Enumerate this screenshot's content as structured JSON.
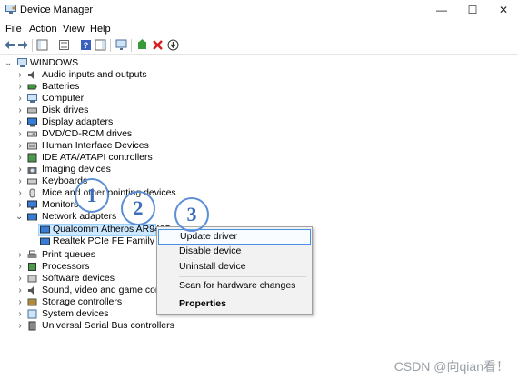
{
  "window": {
    "title": "Device Manager",
    "controls": {
      "minimize": "—",
      "maximize": "☐",
      "close": "✕"
    }
  },
  "menu": [
    "File",
    "Action",
    "View",
    "Help"
  ],
  "toolbar_icons": [
    "back-arrow-icon",
    "forward-arrow-icon",
    "show-hide-icon",
    "properties-icon",
    "help-icon",
    "action-pane-icon",
    "scan-hardware-icon",
    "add-driver-icon",
    "uninstall-icon",
    "update-driver-icon"
  ],
  "tree": {
    "root": "WINDOWS",
    "categories": [
      "Audio inputs and outputs",
      "Batteries",
      "Computer",
      "Disk drives",
      "Display adapters",
      "DVD/CD-ROM drives",
      "Human Interface Devices",
      "IDE ATA/ATAPI controllers",
      "Imaging devices",
      "Keyboards",
      "Mice and other pointing devices",
      "Monitors",
      "Network adapters",
      "Qualcomm Atheros AR9485",
      "Realtek PCIe FE Family Contr",
      "Print queues",
      "Processors",
      "Software devices",
      "Sound, video and game controll",
      "Storage controllers",
      "System devices",
      "Universal Serial Bus controllers"
    ]
  },
  "context_menu": {
    "items": [
      "Update driver",
      "Disable device",
      "Uninstall device",
      "Scan for hardware changes",
      "Properties"
    ]
  },
  "annotations": [
    "1",
    "2",
    "3"
  ],
  "watermark": "CSDN @向qian看！",
  "colors": {
    "selection": "#cce8ff",
    "badge": "#3b6dbb",
    "highlight_border": "#4a90e2"
  }
}
